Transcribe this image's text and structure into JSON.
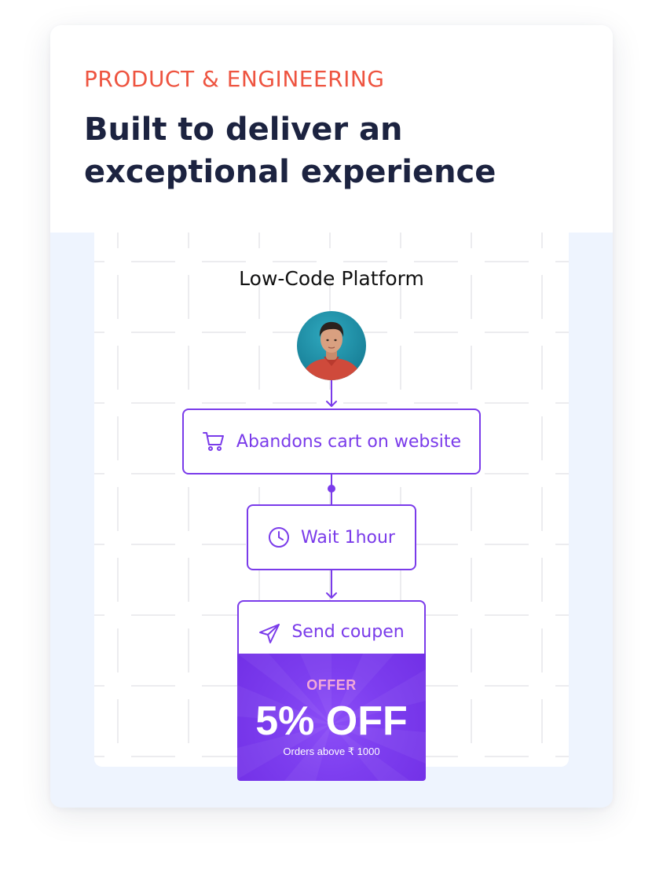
{
  "header": {
    "eyebrow": "PRODUCT & ENGINEERING",
    "headline": "Built to deliver an exceptional experience"
  },
  "platform": {
    "title": "Low-Code Platform",
    "avatar_icon": "user-avatar-photo"
  },
  "flow": {
    "steps": [
      {
        "icon": "shopping-cart-icon",
        "label": "Abandons cart on website"
      },
      {
        "icon": "clock-icon",
        "label": "Wait 1hour"
      },
      {
        "icon": "paper-plane-icon",
        "label": "Send coupen"
      }
    ]
  },
  "coupon": {
    "offer_label": "OFFER",
    "value": "5% OFF",
    "condition": "Orders above ₹ 1000"
  },
  "colors": {
    "accent": "#7a3bea",
    "eyebrow": "#ee5440",
    "headline": "#1c2340",
    "card_background": "#eef4fe",
    "coupon_pink": "#f2a9d8"
  }
}
